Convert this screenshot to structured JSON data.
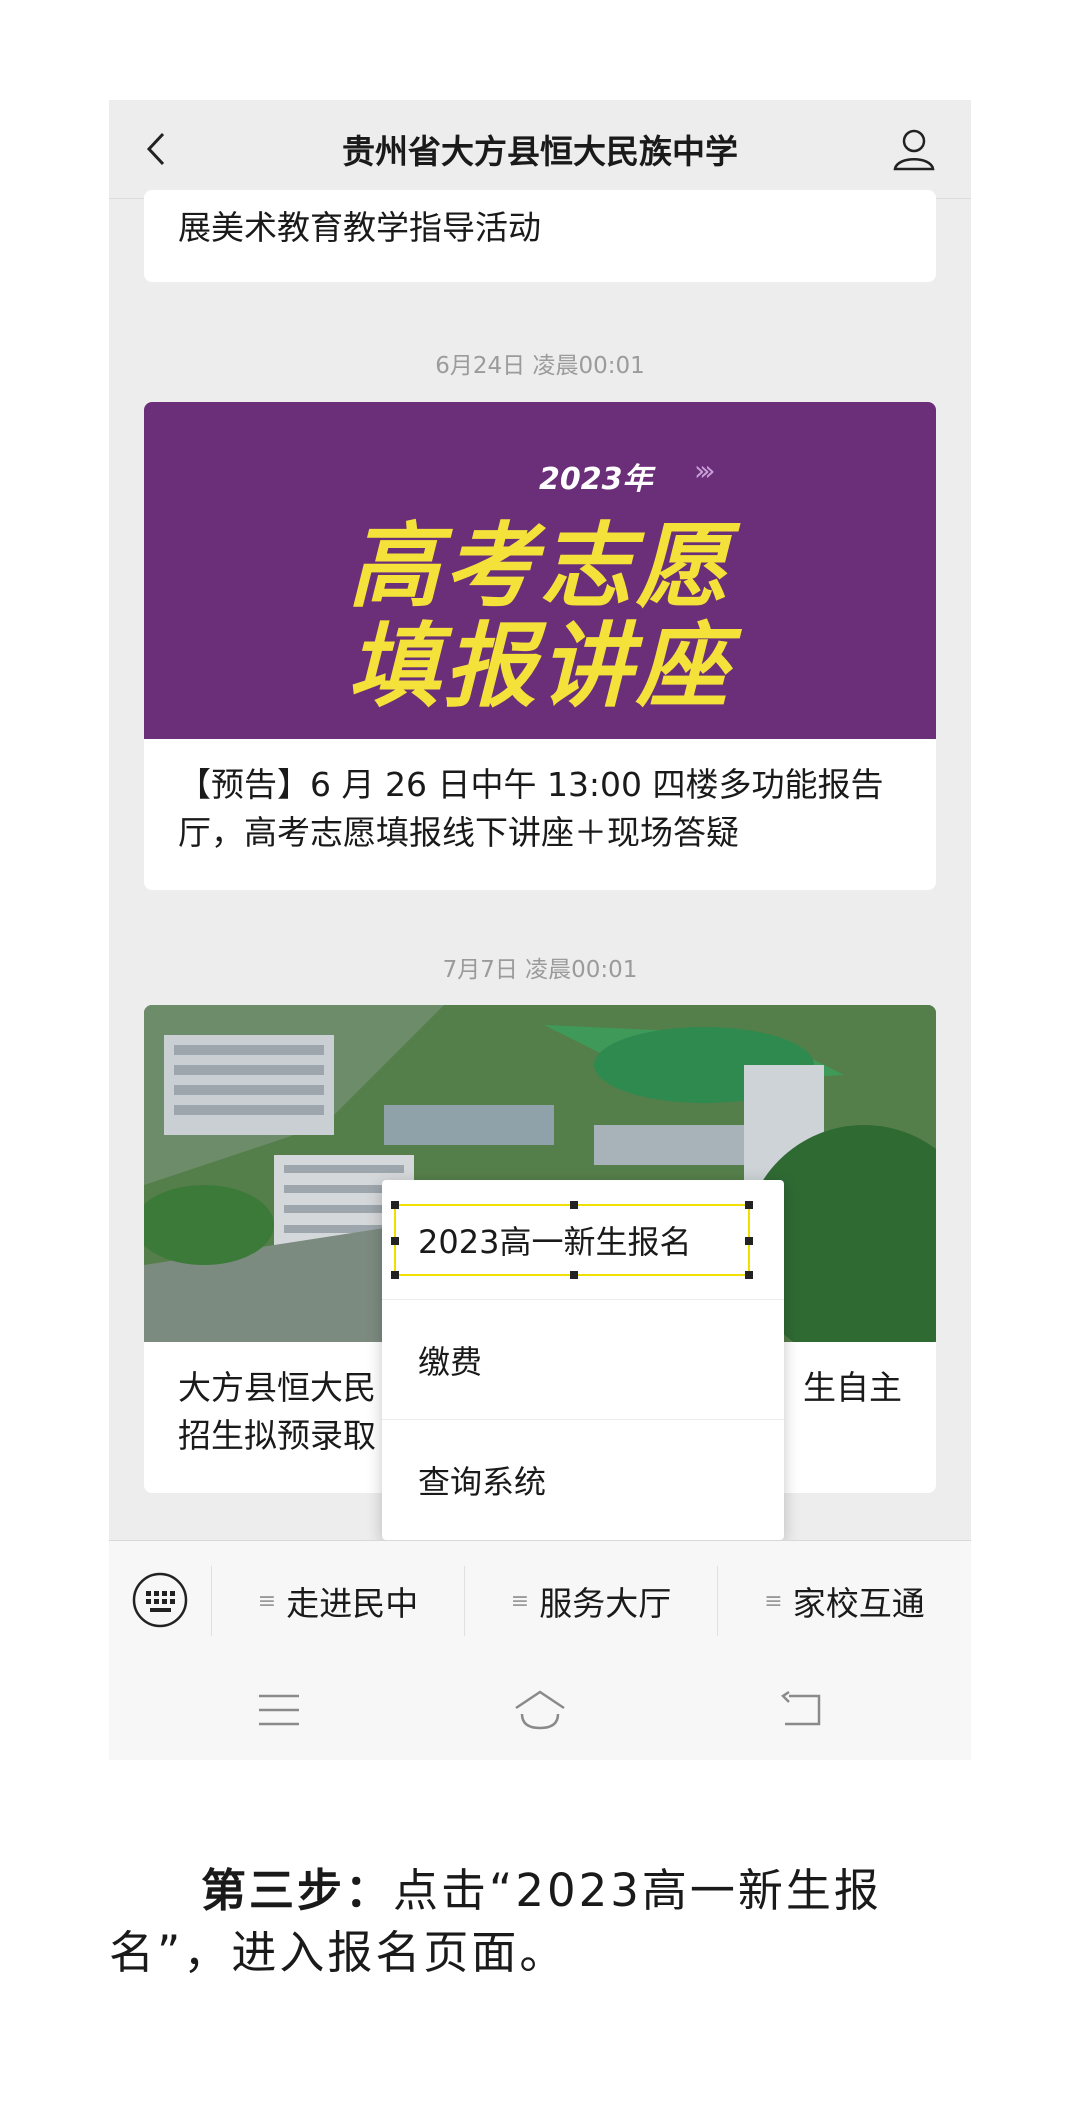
{
  "header": {
    "title": "贵州省大方县恒大民族中学"
  },
  "feed": {
    "card0_text": "展美术教育教学指导活动",
    "time1": "6月24日 凌晨00:01",
    "card1": {
      "banner_year": "2023年",
      "banner_line1": "高考志愿",
      "banner_line2": "填报讲座",
      "text": "【预告】6 月 26 日中午 13:00 四楼多功能报告厅，高考志愿填报线下讲座＋现场答疑"
    },
    "time2": "7月7日 凌晨00:01",
    "card2": {
      "text_left": "大方县恒大民",
      "text_right": "生自主",
      "text_left2": "招生拟预录取"
    }
  },
  "popup_menu": {
    "items": [
      {
        "label": "2023高一新生报名"
      },
      {
        "label": "缴费"
      },
      {
        "label": "查询系统"
      }
    ]
  },
  "bottom_menu": {
    "tabs": [
      {
        "label": "走进民中"
      },
      {
        "label": "服务大厅"
      },
      {
        "label": "家校互通"
      }
    ]
  },
  "caption": {
    "bold": "第三步：",
    "text": "点击“2023高一新生报名”，进入报名页面。"
  },
  "colors": {
    "banner_purple": "#6b2e78",
    "banner_yellow": "#f4e23a",
    "highlight_yellow": "#f0e000"
  }
}
